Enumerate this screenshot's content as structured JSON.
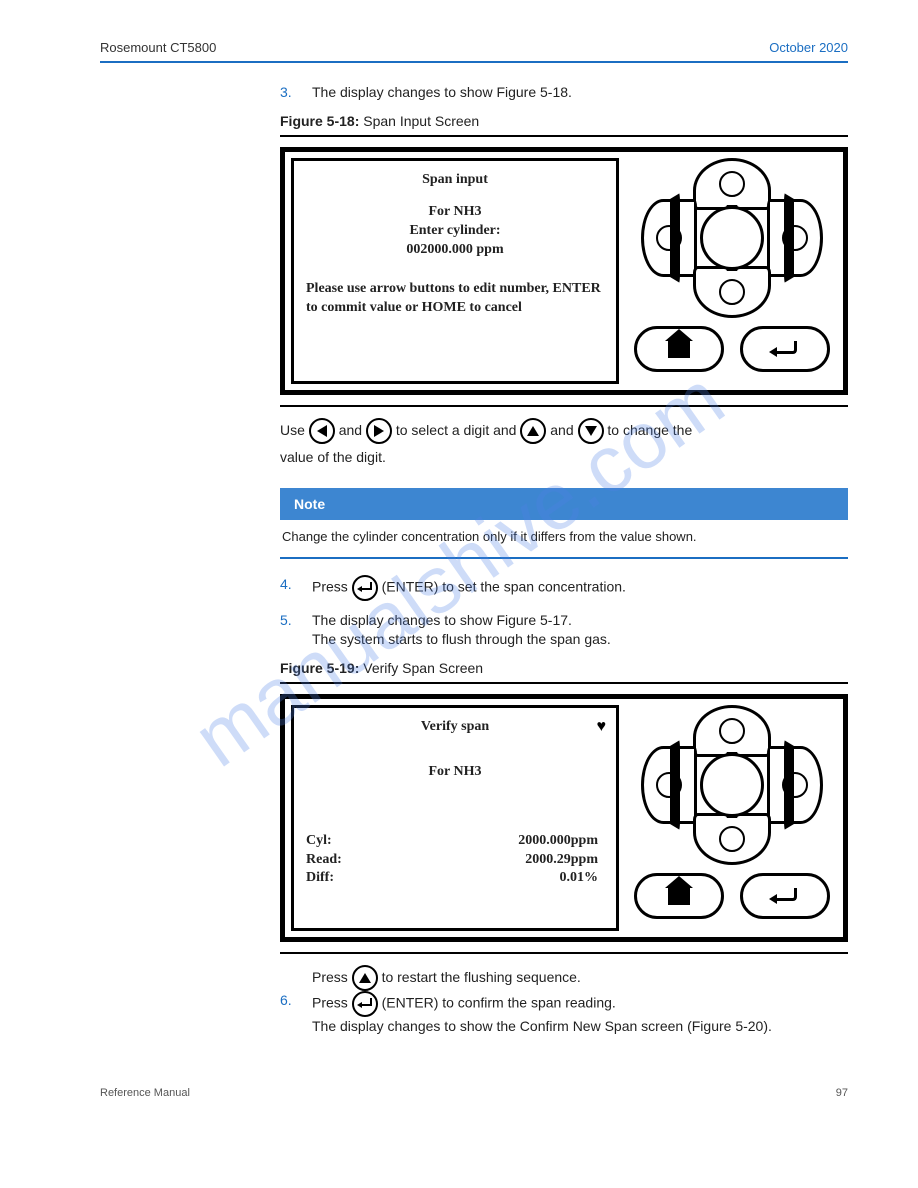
{
  "header": {
    "left": "Rosemount CT5800",
    "right": "October 2020"
  },
  "watermark": "manualshive.com",
  "step3": {
    "num": "3.",
    "text": "The display changes to show Figure 5-18."
  },
  "figure1": {
    "caption_num": "Figure 5-18:",
    "caption_text": "Span Input Screen",
    "title": "Span input",
    "for": "For NH3",
    "enter_label": "Enter cylinder:",
    "value": "002000.000 ppm",
    "instruction": "Please use arrow buttons to edit number, ENTER to commit value or HOME to cancel"
  },
  "instr_line_1a": "Use ",
  "instr_line_1b": " and ",
  "instr_line_1c": " to select a digit and ",
  "instr_line_1d": " and ",
  "instr_line_1e": " to change the",
  "instr_line_2": "value of the digit.",
  "note": {
    "title": "Note",
    "text": "Change the cylinder concentration only if it differs from the value shown."
  },
  "step4": {
    "num": "4.",
    "pre": "Press ",
    "post": " (ENTER) to set the span concentration."
  },
  "step5a_num": "5.",
  "step5a_text_1": "The display changes to show Figure 5-17.",
  "step5a_text_2": "The system starts to flush through the span gas.",
  "figure2": {
    "caption_num": "Figure 5-19:",
    "caption_text": "Verify Span Screen",
    "title": "Verify span",
    "for": "For NH3",
    "rows": {
      "cyl_label": "Cyl:",
      "cyl_value": "2000.000ppm",
      "read_label": "Read:",
      "read_value": "2000.29ppm",
      "diff_label": "Diff:",
      "diff_value": "0.01%"
    }
  },
  "step5b_pre": "Press ",
  "step5b_post": " to restart the flushing sequence.",
  "step6": {
    "num": "6.",
    "pre": "Press ",
    "post": " (ENTER) to confirm the span reading."
  },
  "step6_after": "The display changes to show the Confirm New Span screen (Figure 5-20).",
  "footer": {
    "left": "Reference Manual",
    "right": "97"
  }
}
